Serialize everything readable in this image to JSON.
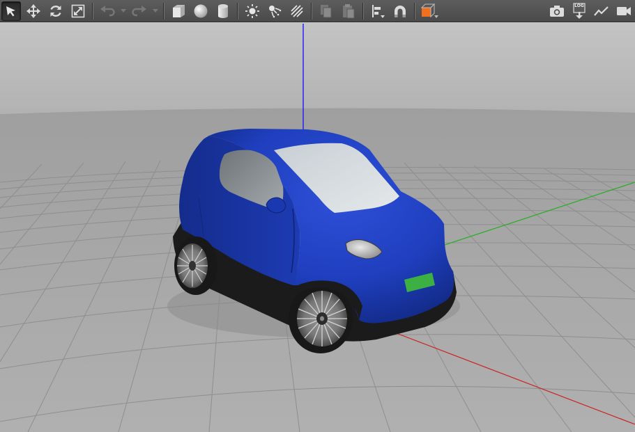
{
  "toolbar": {
    "left_tools": [
      {
        "name": "select-mode-icon",
        "active": true
      },
      {
        "name": "translate-mode-icon",
        "active": false
      },
      {
        "name": "rotate-mode-icon",
        "active": false
      },
      {
        "name": "scale-mode-icon",
        "active": false
      }
    ],
    "history_tools": [
      "undo-icon",
      "undo-history-dropdown-icon",
      "redo-icon",
      "redo-history-dropdown-icon"
    ],
    "shape_tools": [
      "box-shape-icon",
      "sphere-shape-icon",
      "cylinder-shape-icon"
    ],
    "light_tools": [
      "point-light-icon",
      "spot-light-icon",
      "directional-light-icon"
    ],
    "clipboard_tools": [
      "copy-icon",
      "paste-icon"
    ],
    "align_tools": [
      "align-icon",
      "snap-icon"
    ],
    "view_tools": [
      "view-angle-icon"
    ],
    "right_tools": [
      "screenshot-icon",
      "log-icon",
      "plot-icon",
      "video-record-icon"
    ],
    "log_label": "LOG"
  },
  "colors": {
    "toolbar_bg": "#4f4f4f",
    "sky": "#b9b9b9",
    "ground": "#a6a6a6",
    "grid_line": "#8c8c8c",
    "x_axis": "#cc2020",
    "y_axis": "#20b020",
    "z_axis": "#1a1aff",
    "car_body": "#1f3fbf",
    "car_glass": "#d9dfe3",
    "license_plate": "#3cb043",
    "view_angle_accent": "#f07020"
  },
  "scene": {
    "model": "car",
    "selected": false,
    "axes_visible": true,
    "grid_visible": true
  }
}
